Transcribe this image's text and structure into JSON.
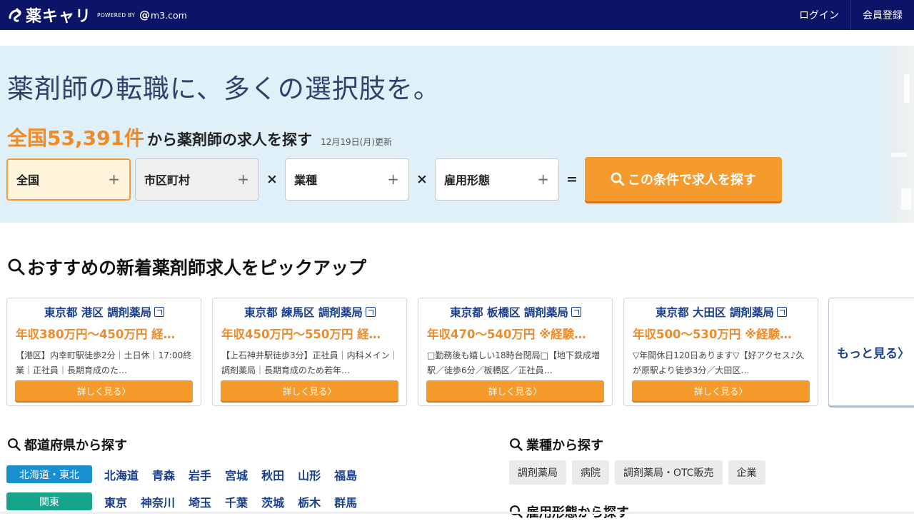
{
  "header": {
    "logo_text": "薬キャリ",
    "powered_by": "POWERED BY",
    "partner": "m3.com",
    "login": "ログイン",
    "register": "会員登録"
  },
  "hero": {
    "tagline": "薬剤師の転職に、多くの選択肢を。",
    "count_prefix": "全国53,391件",
    "count_suffix": "から薬剤師の求人を探す",
    "updated": "12月19日(月)更新",
    "filters": [
      {
        "label": "全国",
        "plus": "+"
      },
      {
        "label": "市区町村",
        "plus": "+"
      },
      {
        "label": "業種",
        "plus": "+"
      },
      {
        "label": "雇用形態",
        "plus": "+"
      }
    ],
    "op_times": "×",
    "op_equals": "=",
    "search_button": "この条件で求人を探す"
  },
  "pickup": {
    "title": "おすすめの新着薬剤師求人をピックアップ",
    "cards": [
      {
        "head": "東京都 港区 調剤薬局",
        "salary": "年収380万円～450万円 経…",
        "desc": "【港区】内幸町駅徒歩2分｜土日休｜17:00終業｜正社員｜長期育成のた…",
        "button": "詳しく見る〉"
      },
      {
        "head": "東京都 練馬区 調剤薬局",
        "salary": "年収450万円～550万円 経…",
        "desc": "【上石神井駅徒歩3分】正社員｜内科メイン｜調剤薬局｜長期育成のため若年…",
        "button": "詳しく見る〉"
      },
      {
        "head": "東京都 板橋区 調剤薬局",
        "salary": "年収470～540万円 ※経験…",
        "desc": "□勤務後も嬉しい18時台閉局□【地下鉄成増駅／徒歩6分／板橋区／正社員…",
        "button": "詳しく見る〉"
      },
      {
        "head": "東京都 大田区 調剤薬局",
        "salary": "年収500～530万円 ※経験…",
        "desc": "▽年間休日120日あります▽【好アクセス♪久が原駅より徒歩3分／大田区…",
        "button": "詳しく見る〉"
      }
    ],
    "more": "もっと見る〉"
  },
  "prefecture": {
    "title": "都道府県から探す",
    "regions": [
      {
        "name": "北海道・東北",
        "color": "#1a8fd0",
        "prefs": [
          "北海道",
          "青森",
          "岩手",
          "宮城",
          "秋田",
          "山形",
          "福島"
        ]
      },
      {
        "name": "関東",
        "color": "#16a58a",
        "prefs": [
          "東京",
          "神奈川",
          "埼玉",
          "千葉",
          "茨城",
          "栃木",
          "群馬"
        ]
      }
    ]
  },
  "industry": {
    "title": "業種から探す",
    "tags": [
      "調剤薬局",
      "病院",
      "調剤薬局・OTC販売",
      "企業"
    ]
  },
  "employment": {
    "title": "雇用形態から探す"
  },
  "colors": {
    "navy": "#0b1466",
    "accent": "#f59a2c",
    "link": "#1a3f8a",
    "hero_bg": "#dff0f8"
  }
}
